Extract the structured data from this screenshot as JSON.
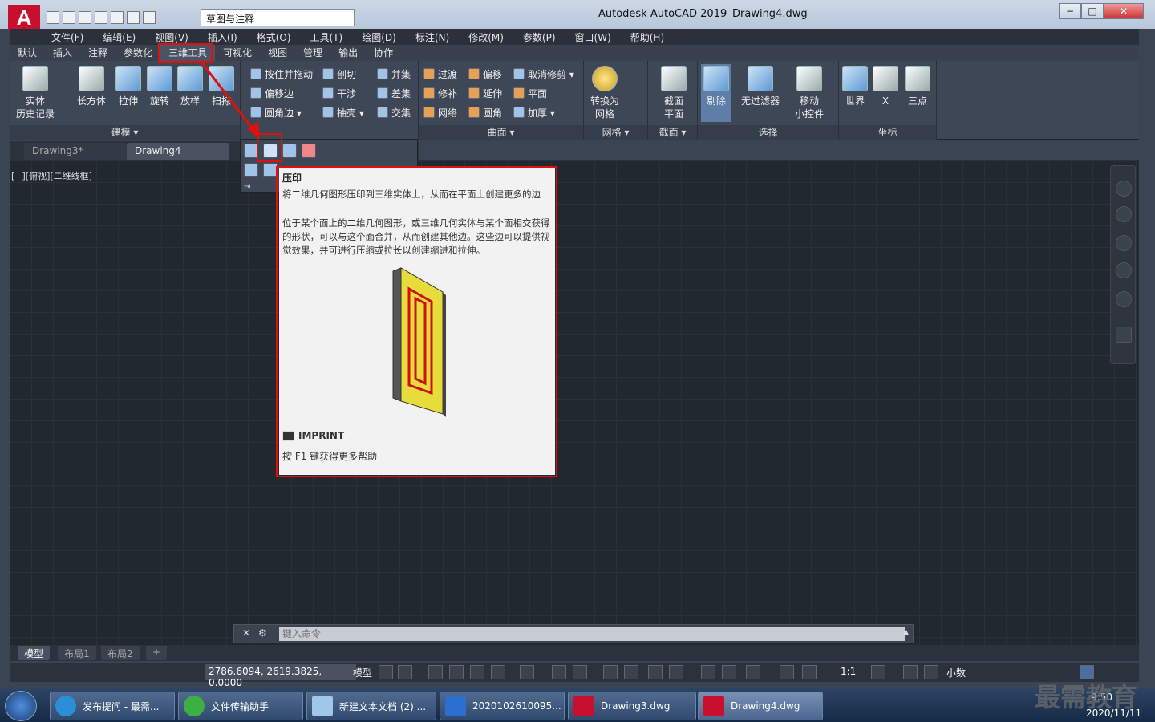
{
  "window": {
    "app_title": "Autodesk AutoCAD 2019",
    "doc_title": "Drawing4.dwg",
    "app_logo": "A",
    "workspace": "草图与注释",
    "minimize": "−",
    "restore": "□",
    "close": "✕"
  },
  "menubar": [
    "文件(F)",
    "编辑(E)",
    "视图(V)",
    "插入(I)",
    "格式(O)",
    "工具(T)",
    "绘图(D)",
    "标注(N)",
    "修改(M)",
    "参数(P)",
    "窗口(W)",
    "帮助(H)"
  ],
  "ribbon_tabs": [
    "默认",
    "插入",
    "注释",
    "参数化",
    "三维工具",
    "可视化",
    "视图",
    "管理",
    "输出",
    "协作"
  ],
  "ribbon_active_tab": "三维工具",
  "panels": {
    "modeling": {
      "label": "建模 ▾",
      "solid_history": "实体\n历史记录",
      "box": "长方体",
      "extrude": "拉伸",
      "revolve": "旋转",
      "loft": "放样",
      "sweep": "扫掠"
    },
    "solid_edit": {
      "presspull": "按住并拖动",
      "offset_edge": "偏移边",
      "fillet_edge": "圆角边 ▾",
      "slice": "剖切",
      "interfere": "干涉",
      "shell": "抽壳 ▾",
      "union": "并集",
      "subtract": "差集",
      "intersect": "交集"
    },
    "surface": {
      "label": "曲面 ▾",
      "blend": "过渡",
      "offset": "偏移",
      "untrim": "取消修剪 ▾",
      "patch": "修补",
      "extend": "延伸",
      "planar": "平面",
      "network": "网络",
      "fillet": "圆角",
      "thicken": "加厚 ▾"
    },
    "mesh": {
      "label": "网格 ▾",
      "convert": "转换为\n网格"
    },
    "section": {
      "label": "截面 ▾",
      "plane": "截面\n平面"
    },
    "selection": {
      "label": "选择",
      "cull": "剔除",
      "nofilter": "无过滤器",
      "gizmo": "移动\n小控件"
    },
    "coordinates": {
      "label": "坐标",
      "world": "世界",
      "x": "X",
      "three_point": "三点"
    }
  },
  "doc_tabs": [
    "Drawing3*",
    "Drawing4"
  ],
  "viewport_label": "[−][俯视][二维线框]",
  "tooltip": {
    "title": "压印",
    "summary": "将二维几何图形压印到三维实体上，从而在平面上创建更多的边",
    "detail": "位于某个面上的二维几何图形，或三维几何实体与某个面相交获得的形状，可以与这个面合并，从而创建其他边。这些边可以提供视觉效果，并可进行压缩或拉长以创建缩进和拉伸。",
    "command": "IMPRINT",
    "help": "按 F1 键获得更多帮助"
  },
  "command_line": {
    "placeholder": "键入命令"
  },
  "layout_tabs": [
    "模型",
    "布局1",
    "布局2",
    "+"
  ],
  "status": {
    "coords": "2786.6094, 2619.3825, 0.0000",
    "model": "模型",
    "scale": "1:1",
    "units": "小数"
  },
  "taskbar": {
    "items": [
      "发布提问 - 最需...",
      "文件传输助手",
      "新建文本文档 (2) ...",
      "2020102610095...",
      "Drawing3.dwg",
      "Drawing4.dwg"
    ],
    "time": "9:50",
    "date": "2020/11/11"
  },
  "watermark": "最需教育",
  "colors": {
    "accent_red": "#e01010",
    "canvas": "#212830",
    "ribbon": "#3e4755"
  }
}
